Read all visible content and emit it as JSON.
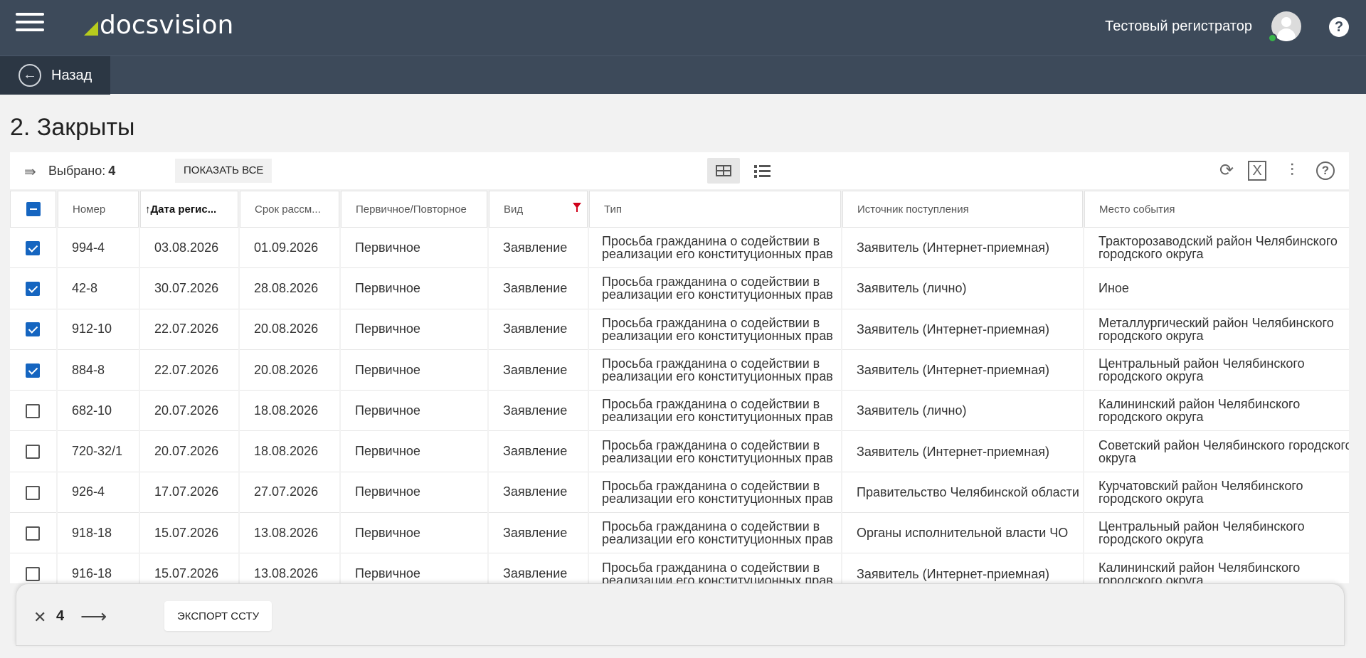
{
  "header": {
    "logo_text": "docsvision",
    "user_name": "Тестовый регистратор",
    "help_symbol": "?",
    "accent_color": "#b7cc1d",
    "bar_color": "#3d4a5a"
  },
  "backbar": {
    "back_label": "Назад"
  },
  "page": {
    "title": "2. Закрыты"
  },
  "toolbar": {
    "selected_label": "Выбрано:",
    "selected_count": "4",
    "show_all_label": "ПОКАЗАТЬ ВСЕ",
    "help_symbol": "?"
  },
  "table": {
    "columns": [
      "Номер",
      "Дата регис...",
      "Срок рассм...",
      "Первичное/Повторное",
      "Вид",
      "Тип",
      "Источник поступления",
      "Место события"
    ],
    "rows": [
      {
        "checked": true,
        "num": "994-4",
        "date": "03.08.2026",
        "due": "01.09.2026",
        "prim": "Первичное",
        "kind": "Заявление",
        "type": "Просьба гражданина о содействии в реализации его конституционных прав",
        "source": "Заявитель (Интернет-приемная)",
        "place": "Тракторозаводский район Челябинского городского округа"
      },
      {
        "checked": true,
        "num": "42-8",
        "date": "30.07.2026",
        "due": "28.08.2026",
        "prim": "Первичное",
        "kind": "Заявление",
        "type": "Просьба гражданина о содействии в реализации его конституционных прав",
        "source": "Заявитель (лично)",
        "place": "Иное"
      },
      {
        "checked": true,
        "num": "912-10",
        "date": "22.07.2026",
        "due": "20.08.2026",
        "prim": "Первичное",
        "kind": "Заявление",
        "type": "Просьба гражданина о содействии в реализации его конституционных прав",
        "source": "Заявитель (Интернет-приемная)",
        "place": "Металлургический район Челябинского городского округа"
      },
      {
        "checked": true,
        "num": "884-8",
        "date": "22.07.2026",
        "due": "20.08.2026",
        "prim": "Первичное",
        "kind": "Заявление",
        "type": "Просьба гражданина о содействии в реализации его конституционных прав",
        "source": "Заявитель (Интернет-приемная)",
        "place": "Центральный район Челябинского городского округа"
      },
      {
        "checked": false,
        "num": "682-10",
        "date": "20.07.2026",
        "due": "18.08.2026",
        "prim": "Первичное",
        "kind": "Заявление",
        "type": "Просьба гражданина о содействии в реализации его конституционных прав",
        "source": "Заявитель (лично)",
        "place": "Калининский район Челябинского городского округа"
      },
      {
        "checked": false,
        "num": "720-32/1",
        "date": "20.07.2026",
        "due": "18.08.2026",
        "prim": "Первичное",
        "kind": "Заявление",
        "type": "Просьба гражданина о содействии в реализации его конституционных прав",
        "source": "Заявитель (Интернет-приемная)",
        "place": "Советский район Челябинского городского округа"
      },
      {
        "checked": false,
        "num": "926-4",
        "date": "17.07.2026",
        "due": "27.07.2026",
        "prim": "Первичное",
        "kind": "Заявление",
        "type": "Просьба гражданина о содействии в реализации его конституционных прав",
        "source": "Правительство Челябинской области",
        "place": "Курчатовский район Челябинского городского округа"
      },
      {
        "checked": false,
        "num": "918-18",
        "date": "15.07.2026",
        "due": "13.08.2026",
        "prim": "Первичное",
        "kind": "Заявление",
        "type": "Просьба гражданина о содействии в реализации его конституционных прав",
        "source": "Органы исполнительной власти ЧО",
        "place": "Центральный район Челябинского городского округа"
      },
      {
        "checked": false,
        "num": "916-18",
        "date": "15.07.2026",
        "due": "13.08.2026",
        "prim": "Первичное",
        "kind": "Заявление",
        "type": "Просьба гражданина о содействии в реализации его конституционных прав",
        "source": "Заявитель (Интернет-приемная)",
        "place": "Калининский район Челябинского городского округа"
      }
    ]
  },
  "actionbar": {
    "count": "4",
    "export_label": "ЭКСПОРТ ССТУ"
  }
}
